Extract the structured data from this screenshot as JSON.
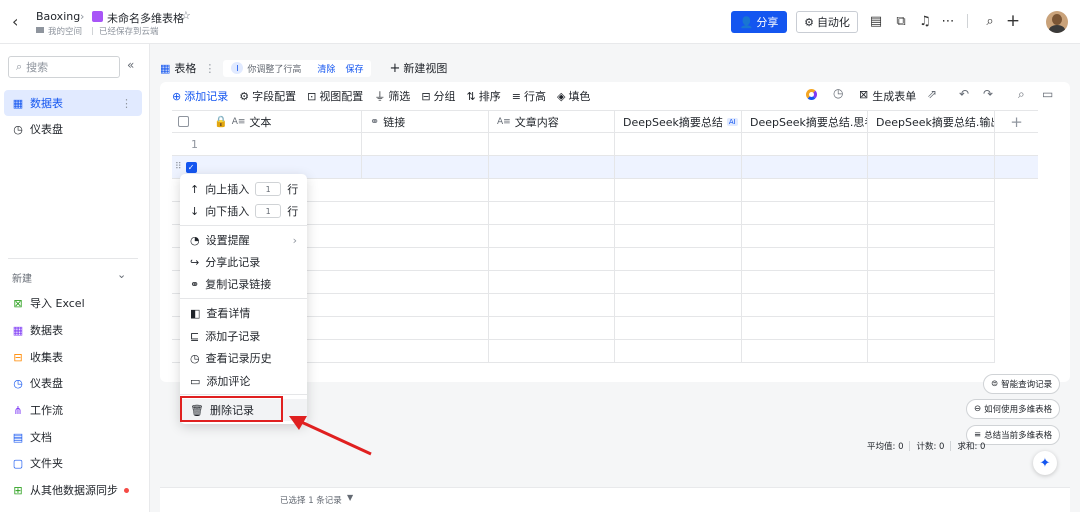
{
  "header": {
    "breadcrumb_root": "Baoxing",
    "doc_title": "未命名多维表格",
    "location": "我的空间",
    "save_status": "已经保存到云端",
    "share_label": "分享",
    "automation_label": "自动化"
  },
  "sidebar": {
    "search_placeholder": "搜索",
    "items": [
      {
        "label": "数据表"
      },
      {
        "label": "仪表盘"
      }
    ],
    "new_label": "新建",
    "create_items": [
      {
        "label": "导入 Excel"
      },
      {
        "label": "数据表"
      },
      {
        "label": "收集表"
      },
      {
        "label": "仪表盘"
      },
      {
        "label": "工作流"
      },
      {
        "label": "文档"
      },
      {
        "label": "文件夹"
      },
      {
        "label": "从其他数据源同步"
      }
    ]
  },
  "tabs": {
    "table_label": "表格",
    "adjust_tip": "你调整了行高",
    "clear_label": "清除",
    "save_label": "保存",
    "new_view_label": "新建视图"
  },
  "toolbar": {
    "add_record": "添加记录",
    "field_config": "字段配置",
    "view_config": "视图配置",
    "filter": "筛选",
    "group": "分组",
    "sort": "排序",
    "row_height": "行高",
    "fill_color": "填色",
    "generate_form": "生成表单"
  },
  "columns": [
    {
      "label": "文本",
      "prefix": "A≡"
    },
    {
      "label": "链接",
      "prefix": "🔗"
    },
    {
      "label": "文章内容",
      "prefix": "A≡"
    },
    {
      "label": "DeepSeek摘要总结",
      "prefix": "",
      "badge": "AI"
    },
    {
      "label": "DeepSeek摘要总结.思考...",
      "prefix": ""
    },
    {
      "label": "DeepSeek摘要总结.输出...",
      "prefix": ""
    }
  ],
  "row_number": "1",
  "context_menu": {
    "insert_above": "向上插入",
    "insert_below": "向下插入",
    "count": "1",
    "row_unit": "行",
    "set_reminder": "设置提醒",
    "share_record": "分享此记录",
    "copy_link": "复制记录链接",
    "view_detail": "查看详情",
    "add_child": "添加子记录",
    "view_history": "查看记录历史",
    "add_comment": "添加评论",
    "delete_record": "删除记录"
  },
  "float_buttons": {
    "smart_query": "智能查询记录",
    "how_to_use": "如何使用多维表格",
    "summarize": "总结当前多维表格"
  },
  "stats": {
    "avg": "平均值: 0",
    "count": "计数: 0",
    "sum": "求和: 0"
  },
  "footer": {
    "selected": "已选择 1 条记录"
  },
  "colors": {
    "accent": "#1456f0",
    "highlight": "#e02020"
  }
}
